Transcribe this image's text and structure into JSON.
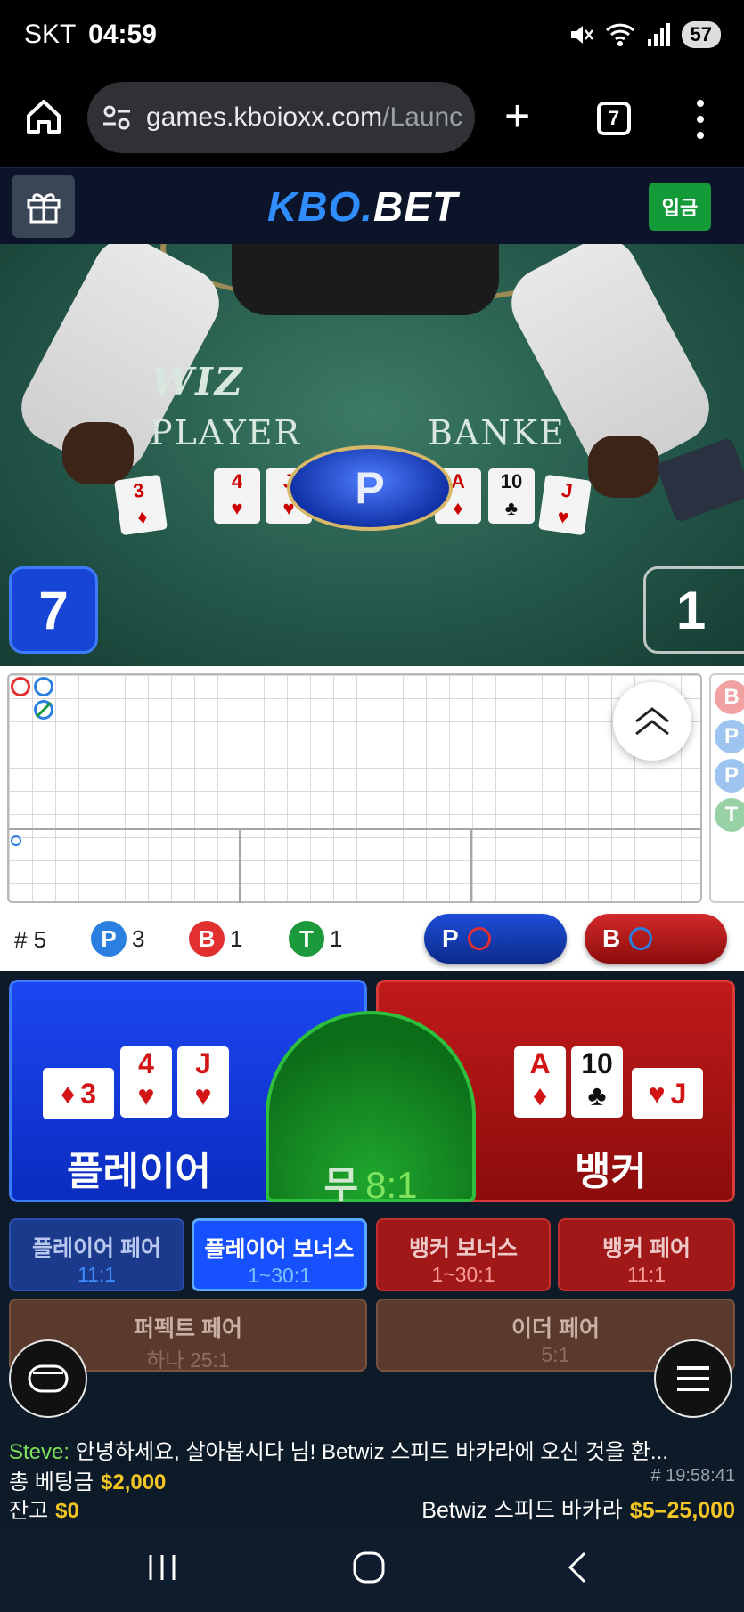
{
  "status_bar": {
    "carrier": "SKT",
    "time": "04:59",
    "battery": "57"
  },
  "browser": {
    "url_host": "games.kboioxx.com",
    "url_path": "/Launc",
    "tab_count": "7"
  },
  "site": {
    "logo_accent": "KBO.",
    "logo_main": "BET",
    "deposit_label": "입금"
  },
  "video": {
    "table_brand": "WIZ",
    "table_player_text": "PLAYER",
    "table_banker_text": "BANKE",
    "result_badge": "P",
    "player_score": "7",
    "banker_score": "1"
  },
  "roadmap": {
    "side_letters": [
      "B",
      "P",
      "P",
      "T"
    ]
  },
  "stats": {
    "round": "# 5",
    "player_letter": "P",
    "player_count": "3",
    "banker_letter": "B",
    "banker_count": "1",
    "tie_letter": "T",
    "tie_count": "1",
    "predict_player": "P",
    "predict_banker": "B"
  },
  "bets": {
    "player_label": "플레이어",
    "banker_label": "뱅커",
    "tie_label": "무",
    "tie_odds": "8:1",
    "player_cards": [
      {
        "rank": "3",
        "suit": "♦",
        "color": "red"
      },
      {
        "rank": "4",
        "suit": "♥",
        "color": "red"
      },
      {
        "rank": "J",
        "suit": "♥",
        "color": "red"
      }
    ],
    "banker_cards": [
      {
        "rank": "A",
        "suit": "♦",
        "color": "red"
      },
      {
        "rank": "10",
        "suit": "♣",
        "color": "black"
      },
      {
        "rank": "J",
        "suit": "♥",
        "color": "red"
      }
    ],
    "side_bets": [
      {
        "name": "플레이어 페어",
        "odds": "11:1"
      },
      {
        "name": "플레이어 보너스",
        "odds": "1~30:1"
      },
      {
        "name": "뱅커 보너스",
        "odds": "1~30:1"
      },
      {
        "name": "뱅커 페어",
        "odds": "11:1"
      },
      {
        "name": "퍼펙트 페어",
        "odds": "하나 25:1"
      },
      {
        "name": "이더 페어",
        "odds": "5:1"
      }
    ]
  },
  "chat": {
    "user": "Steve:",
    "message": "안녕하세요, 살아봅시다 님! Betwiz 스피드 바카라에 오신 것을 환..."
  },
  "summary": {
    "total_bet_label": "총 베팅금",
    "total_bet_value": "$2,000",
    "balance_label": "잔고",
    "balance_value": "$0",
    "round_id": "# 19:58:41",
    "table_name": "Betwiz 스피드 바카라",
    "limits": "$5–25,000"
  },
  "colors": {
    "player_blue": "#1746d6",
    "banker_red": "#c01a1a",
    "tie_green": "#1fa72e",
    "deposit_green": "#159a3a",
    "amount_yellow": "#f3c623"
  }
}
